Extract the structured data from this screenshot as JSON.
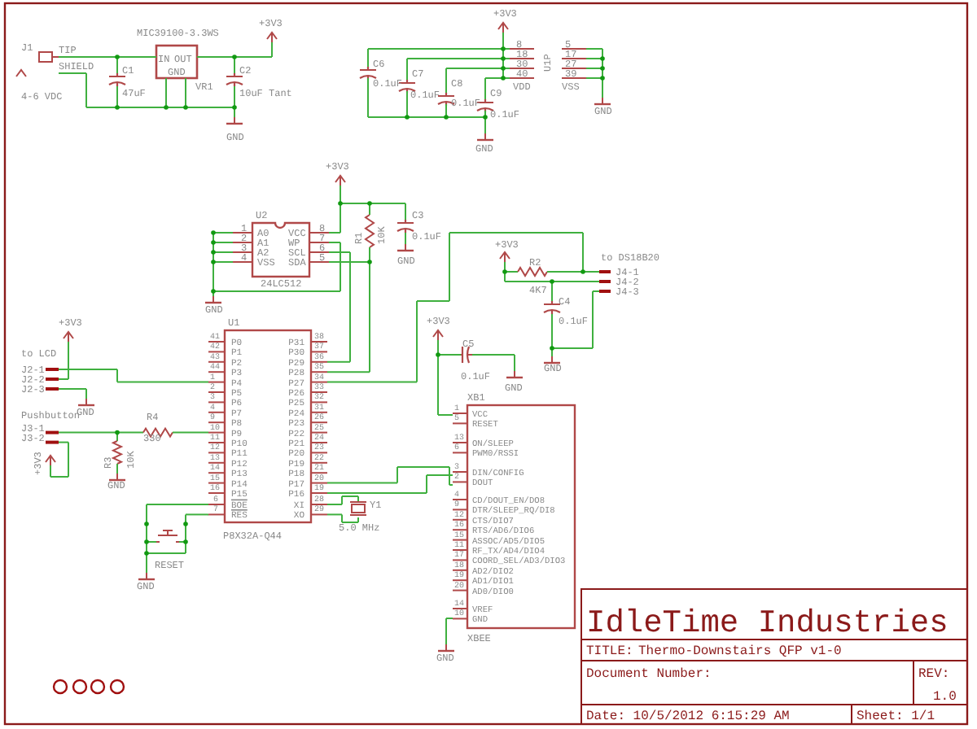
{
  "power_supply": {
    "labels": [
      "+3V3",
      "MIC39100-3.3WS",
      "J1",
      "TIP",
      "IN",
      "OUT",
      "SHIELD",
      "C1",
      "GND",
      "C2",
      "VR1",
      "4-6 VDC",
      "47uF",
      "10uF Tant",
      "GND"
    ]
  },
  "decoupling": {
    "labels": [
      "+3V3",
      "C6",
      "0.1uF",
      "C7",
      "0.1uF",
      "C8",
      "0.1uF",
      "C9",
      "0.1uF",
      "GND",
      "8",
      "18",
      "30",
      "40",
      "VDD",
      "U1P",
      "5",
      "17",
      "27",
      "39",
      "VSS",
      "GND"
    ]
  },
  "eeprom": {
    "labels": [
      "+3V3",
      "U2",
      "1",
      "2",
      "3",
      "4",
      "A0",
      "A1",
      "A2",
      "VSS",
      "8",
      "7",
      "6",
      "5",
      "VCC",
      "WP",
      "SCL",
      "SDA",
      "24LC512",
      "GND",
      "R1",
      "10K",
      "C3",
      "0.1uF",
      "GND"
    ]
  },
  "lcd_connector": {
    "labels": [
      "+3V3",
      "to LCD",
      "J2-1",
      "J2-2",
      "J2-3",
      "GND"
    ]
  },
  "pushbutton": {
    "labels": [
      "Pushbutton",
      "J3-1",
      "J3-2",
      "+3V3",
      "R4",
      "330",
      "R3",
      "10K",
      "GND"
    ]
  },
  "mcu": {
    "ref": "U1",
    "part": "P8X32A-Q44",
    "left_pins": [
      {
        "pin": "41",
        "name": "P0"
      },
      {
        "pin": "42",
        "name": "P1"
      },
      {
        "pin": "43",
        "name": "P2"
      },
      {
        "pin": "44",
        "name": "P3"
      },
      {
        "pin": "1",
        "name": "P4"
      },
      {
        "pin": "2",
        "name": "P5"
      },
      {
        "pin": "3",
        "name": "P6"
      },
      {
        "pin": "4",
        "name": "P7"
      },
      {
        "pin": "9",
        "name": "P8"
      },
      {
        "pin": "10",
        "name": "P9"
      },
      {
        "pin": "11",
        "name": "P10"
      },
      {
        "pin": "12",
        "name": "P11"
      },
      {
        "pin": "13",
        "name": "P12"
      },
      {
        "pin": "14",
        "name": "P13"
      },
      {
        "pin": "15",
        "name": "P14"
      },
      {
        "pin": "16",
        "name": "P15"
      }
    ],
    "right_pins": [
      {
        "pin": "38",
        "name": "P31"
      },
      {
        "pin": "37",
        "name": "P30"
      },
      {
        "pin": "36",
        "name": "P29"
      },
      {
        "pin": "35",
        "name": "P28"
      },
      {
        "pin": "34",
        "name": "P27"
      },
      {
        "pin": "33",
        "name": "P26"
      },
      {
        "pin": "32",
        "name": "P25"
      },
      {
        "pin": "31",
        "name": "P24"
      },
      {
        "pin": "26",
        "name": "P23"
      },
      {
        "pin": "25",
        "name": "P22"
      },
      {
        "pin": "24",
        "name": "P21"
      },
      {
        "pin": "23",
        "name": "P20"
      },
      {
        "pin": "22",
        "name": "P19"
      },
      {
        "pin": "21",
        "name": "P18"
      },
      {
        "pin": "20",
        "name": "P17"
      },
      {
        "pin": "19",
        "name": "P16"
      }
    ],
    "control_pins": [
      {
        "pin": "6",
        "name": "BOE",
        "active_low": true
      },
      {
        "pin": "7",
        "name": "RES",
        "active_low": true
      }
    ],
    "clock_pins": [
      {
        "pin": "28",
        "name": "XI"
      },
      {
        "pin": "29",
        "name": "XO"
      }
    ]
  },
  "crystal_reset": {
    "labels": [
      "Y1",
      "5.0 MHz",
      "RESET",
      "GND"
    ]
  },
  "xbee": {
    "ref": "XB1",
    "part": "XBEE",
    "pins": [
      {
        "pin": "1",
        "name": "VCC"
      },
      {
        "pin": "5",
        "name": "RESET"
      },
      {
        "pin": "13",
        "name": "ON/SLEEP"
      },
      {
        "pin": "6",
        "name": "PWM0/RSSI"
      },
      {
        "pin": "3",
        "name": "DIN/CONFIG"
      },
      {
        "pin": "2",
        "name": "DOUT"
      },
      {
        "pin": "4",
        "name": "CD/DOUT_EN/DO8"
      },
      {
        "pin": "9",
        "name": "DTR/SLEEP_RQ/DI8"
      },
      {
        "pin": "12",
        "name": "CTS/DIO7"
      },
      {
        "pin": "16",
        "name": "RTS/AD6/DIO6"
      },
      {
        "pin": "15",
        "name": "ASSOC/AD5/DIO5"
      },
      {
        "pin": "11",
        "name": "RF_TX/AD4/DIO4"
      },
      {
        "pin": "17",
        "name": "COORD_SEL/AD3/DIO3"
      },
      {
        "pin": "18",
        "name": "AD2/DIO2"
      },
      {
        "pin": "19",
        "name": "AD1/DIO1"
      },
      {
        "pin": "20",
        "name": "AD0/DIO0"
      },
      {
        "pin": "14",
        "name": "VREF"
      },
      {
        "pin": "10",
        "name": "GND"
      }
    ],
    "labels": [
      "+3V3",
      "C5",
      "0.1uF",
      "GND",
      "GND"
    ]
  },
  "temp_sensor": {
    "labels": [
      "+3V3",
      "R2",
      "4K7",
      "to DS18B20",
      "J4-1",
      "J4-2",
      "J4-3",
      "C4",
      "0.1uF",
      "GND"
    ]
  },
  "title_block": {
    "company": "IdleTime Industries",
    "title_label": "TITLE:",
    "title": "Thermo-Downstairs QFP v1-0",
    "document_label": "Document Number:",
    "rev_label": "REV:",
    "rev": "1.0",
    "date": "Date: 10/5/2012 6:15:29 AM",
    "sheet": "Sheet: 1/1"
  }
}
